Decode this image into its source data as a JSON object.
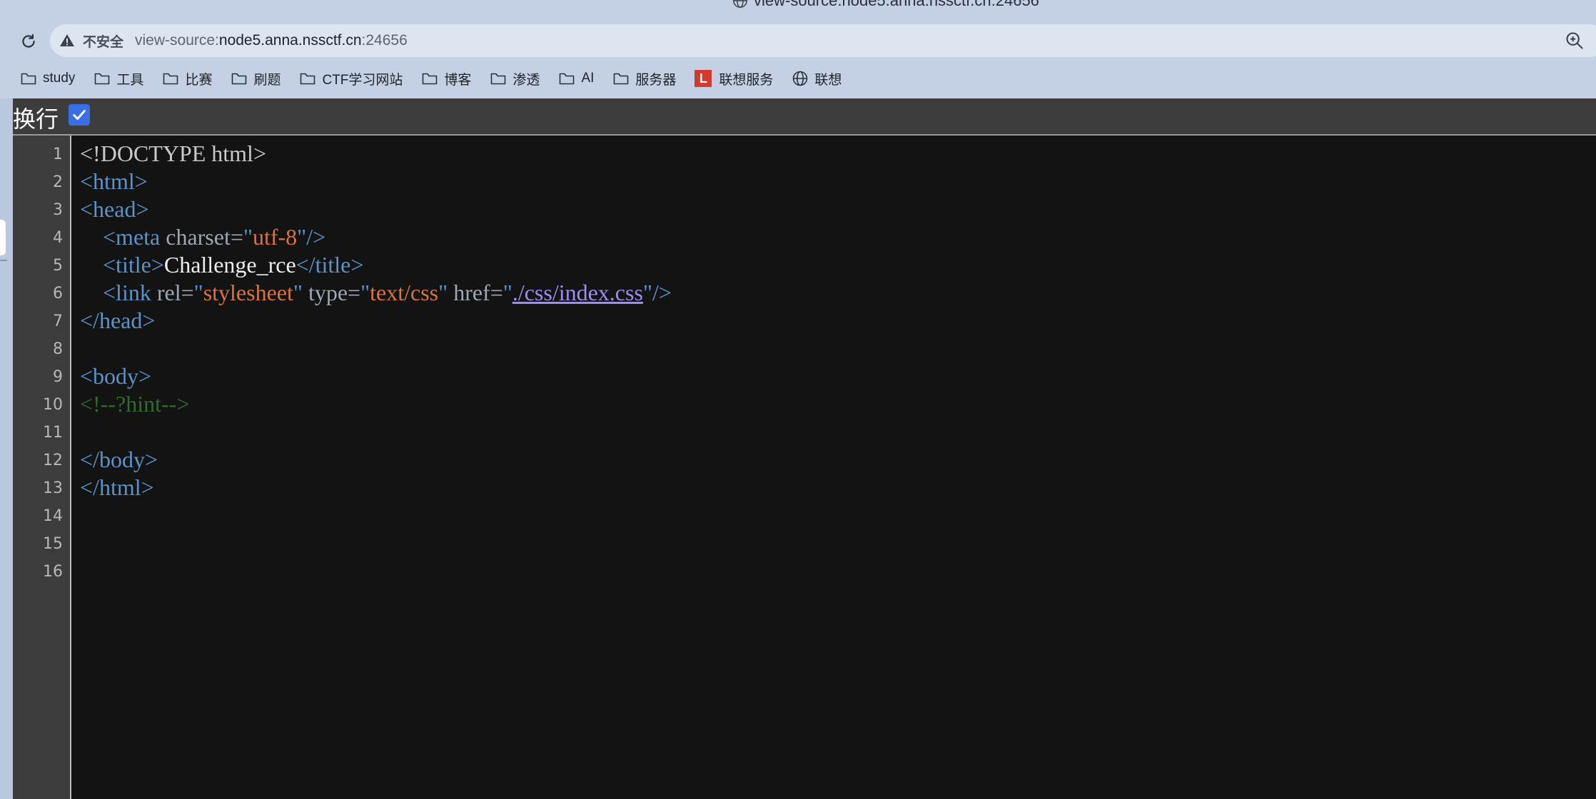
{
  "window": {
    "title": "view-source:node5.anna.nssctf.cn:24656"
  },
  "toolbar": {
    "security_label": "不安全",
    "url_prefix": "view-source:",
    "url_host": "node5.anna.nssctf.cn",
    "url_port": ":24656"
  },
  "bookmarks": [
    {
      "label": "study",
      "icon": "folder-icon"
    },
    {
      "label": "工具",
      "icon": "folder-icon"
    },
    {
      "label": "比赛",
      "icon": "folder-icon"
    },
    {
      "label": "刷题",
      "icon": "folder-icon"
    },
    {
      "label": "CTF学习网站",
      "icon": "folder-icon"
    },
    {
      "label": "博客",
      "icon": "folder-icon"
    },
    {
      "label": "渗透",
      "icon": "folder-icon"
    },
    {
      "label": "AI",
      "icon": "folder-icon"
    },
    {
      "label": "服务器",
      "icon": "folder-icon"
    },
    {
      "label": "联想服务",
      "icon": "lenovo-l-icon",
      "badge": "L"
    },
    {
      "label": "联想",
      "icon": "globe-icon"
    }
  ],
  "viewer": {
    "wrap_label": "换行",
    "wrap_checked": true,
    "line_numbers": [
      "1",
      "2",
      "3",
      "4",
      "5",
      "6",
      "7",
      "8",
      "9",
      "10",
      "11",
      "12",
      "13",
      "14",
      "15",
      "16"
    ],
    "lines": [
      [
        {
          "cls": "doctype",
          "text": "<!DOCTYPE html>"
        }
      ],
      [
        {
          "cls": "tag",
          "text": "<html>"
        }
      ],
      [
        {
          "cls": "tag",
          "text": "<head>"
        }
      ],
      [
        {
          "cls": "txt",
          "text": "    "
        },
        {
          "cls": "tag",
          "text": "<meta "
        },
        {
          "cls": "attr",
          "text": "charset="
        },
        {
          "cls": "tag",
          "text": "\""
        },
        {
          "cls": "val",
          "text": "utf-8"
        },
        {
          "cls": "tag",
          "text": "\"/>"
        }
      ],
      [
        {
          "cls": "txt",
          "text": "    "
        },
        {
          "cls": "tag",
          "text": "<title>"
        },
        {
          "cls": "txt",
          "text": "Challenge_rce"
        },
        {
          "cls": "tag",
          "text": "</title>"
        }
      ],
      [
        {
          "cls": "txt",
          "text": "    "
        },
        {
          "cls": "tag",
          "text": "<link "
        },
        {
          "cls": "attr",
          "text": "rel="
        },
        {
          "cls": "tag",
          "text": "\""
        },
        {
          "cls": "val",
          "text": "stylesheet"
        },
        {
          "cls": "tag",
          "text": "\" "
        },
        {
          "cls": "attr",
          "text": "type="
        },
        {
          "cls": "tag",
          "text": "\""
        },
        {
          "cls": "val",
          "text": "text/css"
        },
        {
          "cls": "tag",
          "text": "\" "
        },
        {
          "cls": "attr",
          "text": "href="
        },
        {
          "cls": "tag",
          "text": "\""
        },
        {
          "cls": "link",
          "text": "./css/index.css"
        },
        {
          "cls": "tag",
          "text": "\"/>"
        }
      ],
      [
        {
          "cls": "tag",
          "text": "</head>"
        }
      ],
      [],
      [
        {
          "cls": "tag",
          "text": "<body>"
        }
      ],
      [
        {
          "cls": "comment",
          "text": "<!--?hint-->"
        }
      ],
      [],
      [
        {
          "cls": "tag",
          "text": "</body>"
        }
      ],
      [
        {
          "cls": "tag",
          "text": "</html>"
        }
      ],
      [],
      [],
      []
    ]
  }
}
